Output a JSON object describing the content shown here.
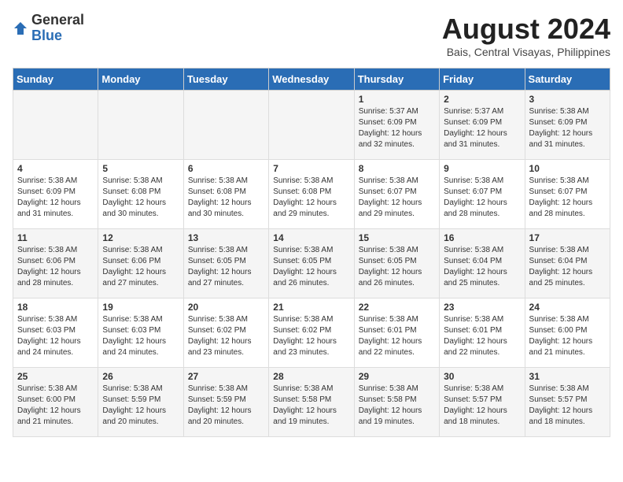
{
  "logo": {
    "general": "General",
    "blue": "Blue"
  },
  "title": {
    "month_year": "August 2024",
    "location": "Bais, Central Visayas, Philippines"
  },
  "headers": [
    "Sunday",
    "Monday",
    "Tuesday",
    "Wednesday",
    "Thursday",
    "Friday",
    "Saturday"
  ],
  "weeks": [
    [
      {
        "day": "",
        "info": ""
      },
      {
        "day": "",
        "info": ""
      },
      {
        "day": "",
        "info": ""
      },
      {
        "day": "",
        "info": ""
      },
      {
        "day": "1",
        "info": "Sunrise: 5:37 AM\nSunset: 6:09 PM\nDaylight: 12 hours\nand 32 minutes."
      },
      {
        "day": "2",
        "info": "Sunrise: 5:37 AM\nSunset: 6:09 PM\nDaylight: 12 hours\nand 31 minutes."
      },
      {
        "day": "3",
        "info": "Sunrise: 5:38 AM\nSunset: 6:09 PM\nDaylight: 12 hours\nand 31 minutes."
      }
    ],
    [
      {
        "day": "4",
        "info": "Sunrise: 5:38 AM\nSunset: 6:09 PM\nDaylight: 12 hours\nand 31 minutes."
      },
      {
        "day": "5",
        "info": "Sunrise: 5:38 AM\nSunset: 6:08 PM\nDaylight: 12 hours\nand 30 minutes."
      },
      {
        "day": "6",
        "info": "Sunrise: 5:38 AM\nSunset: 6:08 PM\nDaylight: 12 hours\nand 30 minutes."
      },
      {
        "day": "7",
        "info": "Sunrise: 5:38 AM\nSunset: 6:08 PM\nDaylight: 12 hours\nand 29 minutes."
      },
      {
        "day": "8",
        "info": "Sunrise: 5:38 AM\nSunset: 6:07 PM\nDaylight: 12 hours\nand 29 minutes."
      },
      {
        "day": "9",
        "info": "Sunrise: 5:38 AM\nSunset: 6:07 PM\nDaylight: 12 hours\nand 28 minutes."
      },
      {
        "day": "10",
        "info": "Sunrise: 5:38 AM\nSunset: 6:07 PM\nDaylight: 12 hours\nand 28 minutes."
      }
    ],
    [
      {
        "day": "11",
        "info": "Sunrise: 5:38 AM\nSunset: 6:06 PM\nDaylight: 12 hours\nand 28 minutes."
      },
      {
        "day": "12",
        "info": "Sunrise: 5:38 AM\nSunset: 6:06 PM\nDaylight: 12 hours\nand 27 minutes."
      },
      {
        "day": "13",
        "info": "Sunrise: 5:38 AM\nSunset: 6:05 PM\nDaylight: 12 hours\nand 27 minutes."
      },
      {
        "day": "14",
        "info": "Sunrise: 5:38 AM\nSunset: 6:05 PM\nDaylight: 12 hours\nand 26 minutes."
      },
      {
        "day": "15",
        "info": "Sunrise: 5:38 AM\nSunset: 6:05 PM\nDaylight: 12 hours\nand 26 minutes."
      },
      {
        "day": "16",
        "info": "Sunrise: 5:38 AM\nSunset: 6:04 PM\nDaylight: 12 hours\nand 25 minutes."
      },
      {
        "day": "17",
        "info": "Sunrise: 5:38 AM\nSunset: 6:04 PM\nDaylight: 12 hours\nand 25 minutes."
      }
    ],
    [
      {
        "day": "18",
        "info": "Sunrise: 5:38 AM\nSunset: 6:03 PM\nDaylight: 12 hours\nand 24 minutes."
      },
      {
        "day": "19",
        "info": "Sunrise: 5:38 AM\nSunset: 6:03 PM\nDaylight: 12 hours\nand 24 minutes."
      },
      {
        "day": "20",
        "info": "Sunrise: 5:38 AM\nSunset: 6:02 PM\nDaylight: 12 hours\nand 23 minutes."
      },
      {
        "day": "21",
        "info": "Sunrise: 5:38 AM\nSunset: 6:02 PM\nDaylight: 12 hours\nand 23 minutes."
      },
      {
        "day": "22",
        "info": "Sunrise: 5:38 AM\nSunset: 6:01 PM\nDaylight: 12 hours\nand 22 minutes."
      },
      {
        "day": "23",
        "info": "Sunrise: 5:38 AM\nSunset: 6:01 PM\nDaylight: 12 hours\nand 22 minutes."
      },
      {
        "day": "24",
        "info": "Sunrise: 5:38 AM\nSunset: 6:00 PM\nDaylight: 12 hours\nand 21 minutes."
      }
    ],
    [
      {
        "day": "25",
        "info": "Sunrise: 5:38 AM\nSunset: 6:00 PM\nDaylight: 12 hours\nand 21 minutes."
      },
      {
        "day": "26",
        "info": "Sunrise: 5:38 AM\nSunset: 5:59 PM\nDaylight: 12 hours\nand 20 minutes."
      },
      {
        "day": "27",
        "info": "Sunrise: 5:38 AM\nSunset: 5:59 PM\nDaylight: 12 hours\nand 20 minutes."
      },
      {
        "day": "28",
        "info": "Sunrise: 5:38 AM\nSunset: 5:58 PM\nDaylight: 12 hours\nand 19 minutes."
      },
      {
        "day": "29",
        "info": "Sunrise: 5:38 AM\nSunset: 5:58 PM\nDaylight: 12 hours\nand 19 minutes."
      },
      {
        "day": "30",
        "info": "Sunrise: 5:38 AM\nSunset: 5:57 PM\nDaylight: 12 hours\nand 18 minutes."
      },
      {
        "day": "31",
        "info": "Sunrise: 5:38 AM\nSunset: 5:57 PM\nDaylight: 12 hours\nand 18 minutes."
      }
    ]
  ]
}
